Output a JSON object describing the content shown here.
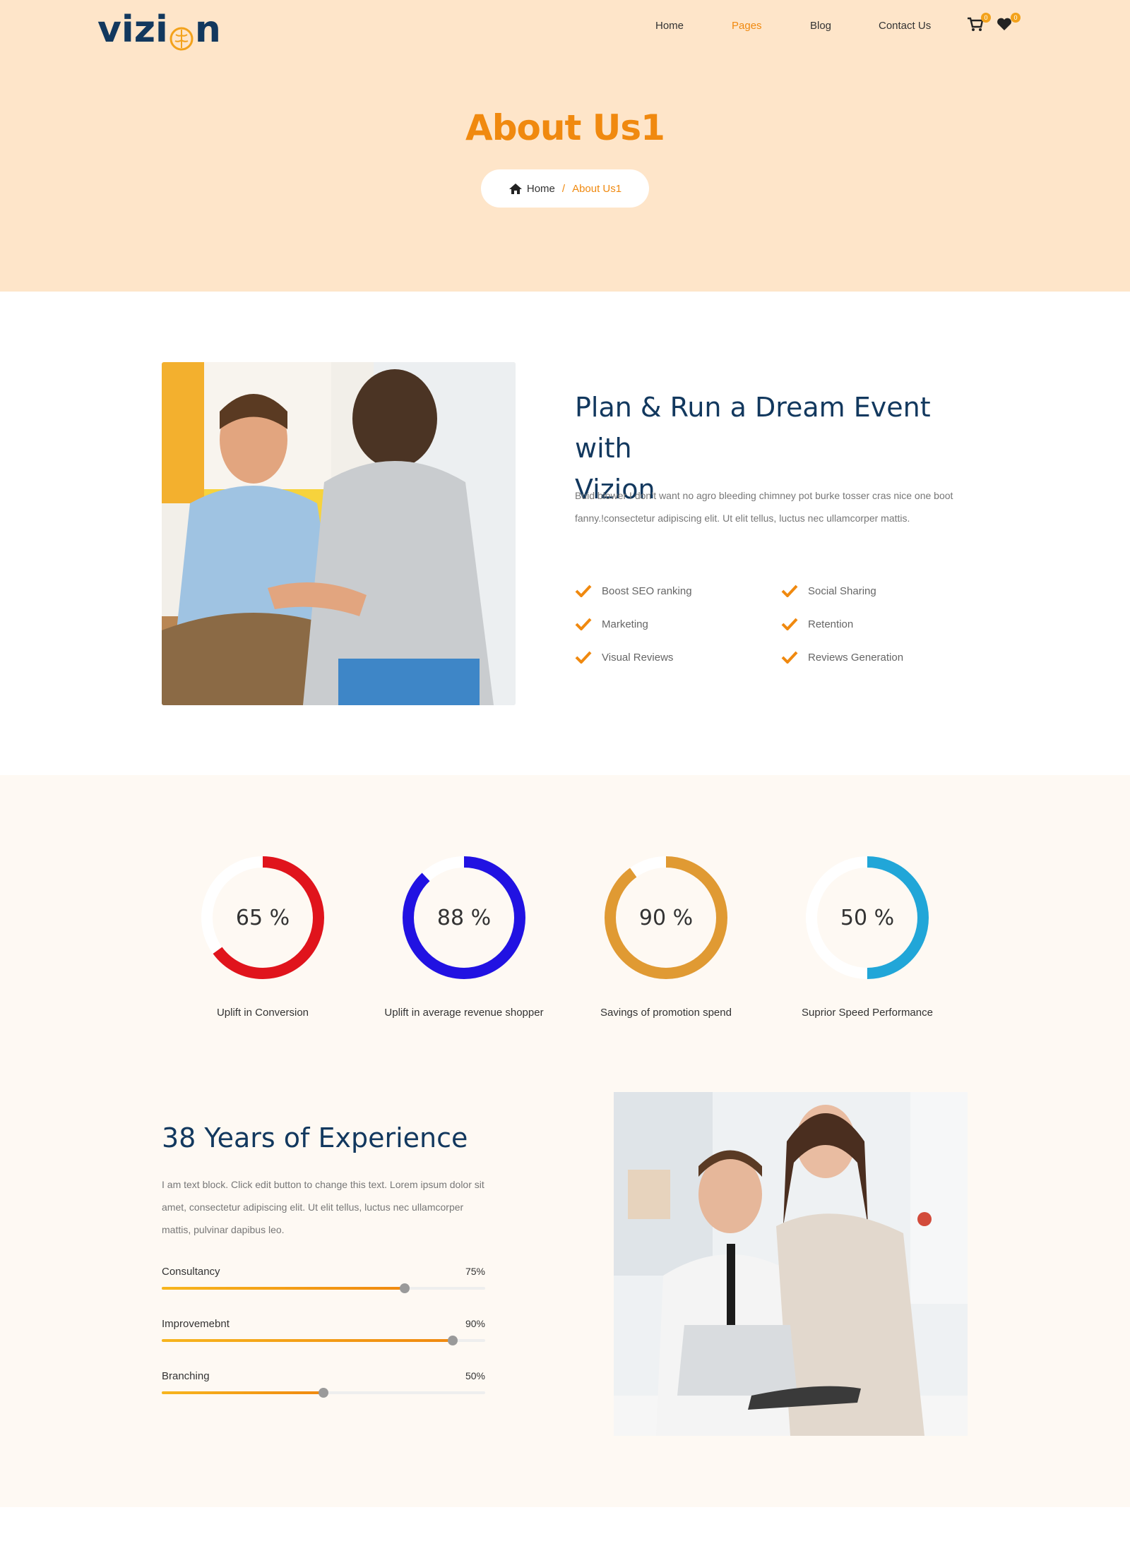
{
  "header": {
    "logo_text_left": "vizi",
    "logo_text_right": "n",
    "nav": [
      {
        "label": "Home",
        "active": false
      },
      {
        "label": "Pages",
        "active": true
      },
      {
        "label": "Blog",
        "active": false
      },
      {
        "label": "Contact Us",
        "active": false
      }
    ],
    "cart_count": "0",
    "wishlist_count": "0"
  },
  "hero": {
    "title": "About Us1",
    "breadcrumb_home": "Home",
    "breadcrumb_sep": "/",
    "breadcrumb_current": "About Us1"
  },
  "about": {
    "title_line1": "Plan & Run a Dream Event with",
    "title_line2": "Vizion",
    "text": "Buid blower I don’t want no agro bleeding chimney pot burke tosser cras nice one boot fanny.!consectetur adipiscing elit. Ut elit tellus, luctus nec ullamcorper mattis.",
    "features": [
      "Boost SEO ranking",
      "Social Sharing",
      "Marketing",
      "Retention",
      "Visual Reviews",
      "Reviews Generation"
    ]
  },
  "stats": [
    {
      "value": 65,
      "display": "65 %",
      "label": "Uplift in Conversion",
      "color": "#e0141c"
    },
    {
      "value": 88,
      "display": "88 %",
      "label": "Uplift in average revenue shopper",
      "color": "#2112e2"
    },
    {
      "value": 90,
      "display": "90 %",
      "label": "Savings of promotion spend",
      "color": "#e09a33"
    },
    {
      "value": 50,
      "display": "50 %",
      "label": "Suprior Speed Performance",
      "color": "#21a6d8"
    }
  ],
  "experience": {
    "title": "38 Years of Experience",
    "text": "I am text block. Click edit button to change this text. Lorem ipsum dolor sit amet, consectetur adipiscing elit. Ut elit tellus, luctus nec ullamcorper mattis, pulvinar dapibus leo.",
    "skills": [
      {
        "name": "Consultancy",
        "pct_label": "75%",
        "value": 0.75
      },
      {
        "name": "Improvemebnt",
        "pct_label": "90%",
        "value": 0.9
      },
      {
        "name": "Branching",
        "pct_label": "50%",
        "value": 0.5
      }
    ]
  },
  "colors": {
    "accent": "#f0890f",
    "navy": "#12385e",
    "hero_bg": "#fee5c9",
    "band_bg": "#fef9f3"
  }
}
